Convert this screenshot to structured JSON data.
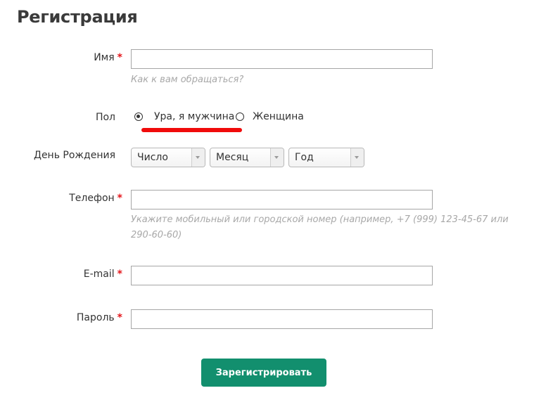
{
  "page": {
    "title": "Регистрация"
  },
  "form": {
    "name": {
      "label": "Имя",
      "required_mark": "*",
      "value": "",
      "hint": "Как к вам обращаться?"
    },
    "gender": {
      "label": "Пол",
      "options": [
        {
          "label": "Ура, я мужчина",
          "checked": true
        },
        {
          "label": "Женщина",
          "checked": false
        }
      ],
      "annotation": "red-underline"
    },
    "birthday": {
      "label": "День Рождения",
      "selects": [
        {
          "value": "Число"
        },
        {
          "value": "Месяц"
        },
        {
          "value": "Год"
        }
      ]
    },
    "phone": {
      "label": "Телефон",
      "required_mark": "*",
      "value": "",
      "hint": "Укажите мобильный или городской номер (например, +7 (999) 123-45-67 или 290-60-60)"
    },
    "email": {
      "label": "E-mail",
      "required_mark": "*",
      "value": ""
    },
    "password": {
      "label": "Пароль",
      "required_mark": "*",
      "value": ""
    },
    "submit_label": "Зарегистрировать"
  },
  "colors": {
    "accent": "#128f6e",
    "required": "#e4161b",
    "hint": "#a8a8a8",
    "annotation": "#f00b0b"
  }
}
